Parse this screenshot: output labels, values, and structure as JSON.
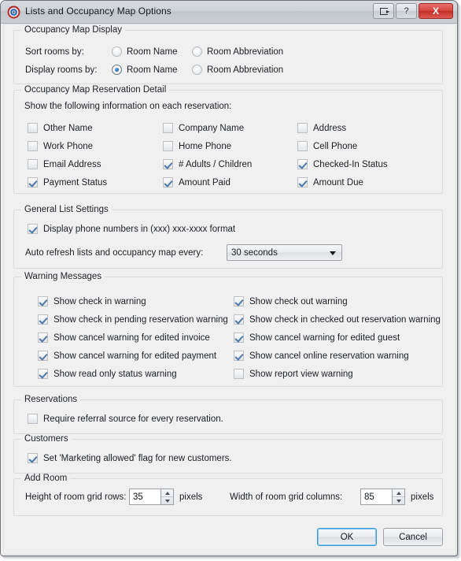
{
  "window": {
    "title": "Lists and Occupancy Map Options",
    "app_icon": "app-logo-icon",
    "buttons": {
      "restore_label": "",
      "restore_icon": "restore-export-icon",
      "help_label": "?",
      "close_label": "X"
    }
  },
  "groups": {
    "occupancy_map_display": {
      "legend": "Occupancy Map Display",
      "rows": [
        {
          "label": "Sort rooms by:",
          "options": [
            {
              "label": "Room Name",
              "checked": false
            },
            {
              "label": "Room Abbreviation",
              "checked": false
            }
          ]
        },
        {
          "label": "Display rooms by:",
          "options": [
            {
              "label": "Room Name",
              "checked": true
            },
            {
              "label": "Room Abbreviation",
              "checked": false
            }
          ]
        }
      ]
    },
    "reservation_detail": {
      "legend": "Occupancy Map Reservation Detail",
      "instruction": "Show the following information on each reservation:",
      "items": [
        {
          "label": "Other Name",
          "checked": false
        },
        {
          "label": "Company Name",
          "checked": false
        },
        {
          "label": "Address",
          "checked": false
        },
        {
          "label": "Work Phone",
          "checked": false
        },
        {
          "label": "Home Phone",
          "checked": false
        },
        {
          "label": "Cell Phone",
          "checked": false
        },
        {
          "label": "Email Address",
          "checked": false
        },
        {
          "label": "# Adults / Children",
          "checked": true
        },
        {
          "label": "Checked-In Status",
          "checked": true
        },
        {
          "label": "Payment Status",
          "checked": true
        },
        {
          "label": "Amount Paid",
          "checked": true
        },
        {
          "label": "Amount Due",
          "checked": true
        }
      ]
    },
    "general_list_settings": {
      "legend": "General List Settings",
      "phone_format": {
        "label": "Display phone numbers in (xxx) xxx-xxxx format",
        "checked": true
      },
      "refresh_label": "Auto refresh lists and occupancy map every:",
      "refresh_value": "30 seconds"
    },
    "warning_messages": {
      "legend": "Warning Messages",
      "items": [
        {
          "label": "Show check in warning",
          "checked": true
        },
        {
          "label": "Show check out warning",
          "checked": true
        },
        {
          "label": "Show check in pending reservation warning",
          "checked": true
        },
        {
          "label": "Show check in checked out reservation warning",
          "checked": true
        },
        {
          "label": "Show cancel warning for edited invoice",
          "checked": true
        },
        {
          "label": "Show cancel warning for edited guest",
          "checked": true
        },
        {
          "label": "Show cancel warning for edited payment",
          "checked": true
        },
        {
          "label": "Show cancel online reservation warning",
          "checked": true
        },
        {
          "label": "Show read only status warning",
          "checked": true
        },
        {
          "label": "Show report view warning",
          "checked": false
        }
      ]
    },
    "reservations": {
      "legend": "Reservations",
      "referral": {
        "label": "Require referral source for every reservation.",
        "checked": false
      }
    },
    "customers": {
      "legend": "Customers",
      "marketing": {
        "label": "Set 'Marketing allowed' flag for new customers.",
        "checked": true
      }
    },
    "add_room": {
      "legend": "Add Room",
      "height_label": "Height of room grid rows:",
      "height_value": "35",
      "height_unit": "pixels",
      "width_label": "Width of room grid columns:",
      "width_value": "85",
      "width_unit": "pixels"
    }
  },
  "footer": {
    "ok_label": "OK",
    "cancel_label": "Cancel"
  },
  "colors": {
    "accent": "#2170c4",
    "check": "#4f79a8",
    "close": "#d8453e",
    "dialog_bg": "#f0f0f0"
  }
}
